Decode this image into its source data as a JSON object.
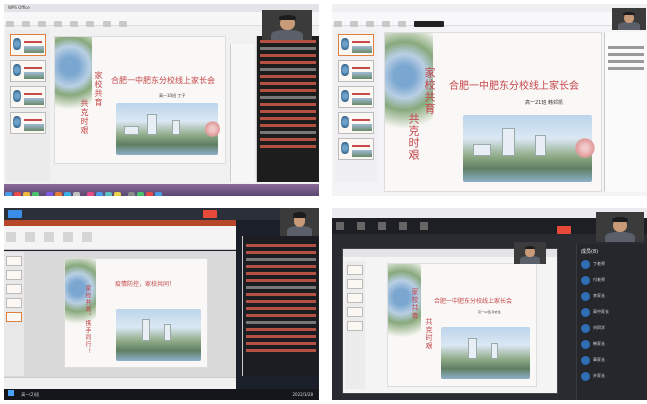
{
  "q1": {
    "app_title": "WPS Office",
    "slide": {
      "title": "合肥一中肥东分校线上家长会",
      "vertical_left": "家校共育",
      "vertical_right": "共克时艰",
      "subtitle": "高一10班 丁子"
    }
  },
  "q2": {
    "slide": {
      "title": "合肥一中肥东分校线上家长会",
      "vertical_left": "家校共育",
      "vertical_right": "共克时艰",
      "subtitle": "高一21班 韩邓凯"
    }
  },
  "q3": {
    "slide": {
      "title": "疫情防控，家校共同！",
      "vertical": "家校共育，携手同行！"
    },
    "taskbar_items": [
      "高一(2)班",
      "2022/3/28"
    ]
  },
  "q4": {
    "participants_header": "成员(8)",
    "participants": [
      "丁老师",
      "付老师",
      "李家长",
      "高中家长",
      "刘同学",
      "韩家长",
      "章家长",
      "许家长"
    ],
    "slide": {
      "title": "合肥一中肥东分校线上家长会",
      "vertical_left": "家校共育",
      "vertical_right": "共克时艰",
      "subtitle": "高一12班 孙亦生"
    }
  },
  "colors": {
    "accent": "#c4464a",
    "brand": "#2f6db5"
  }
}
